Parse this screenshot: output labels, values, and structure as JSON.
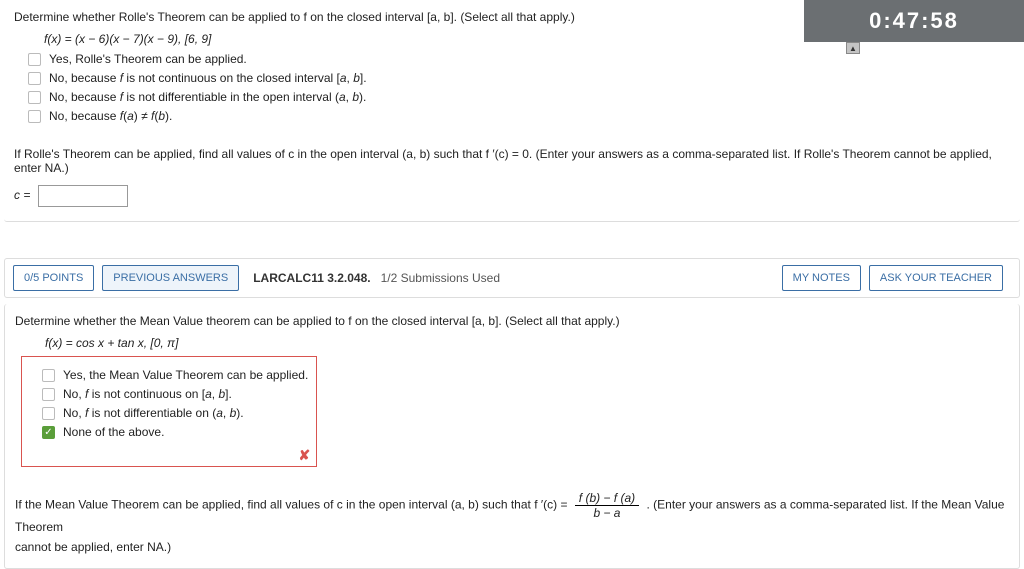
{
  "timer": "0:47:58",
  "q1": {
    "prompt": "Determine whether Rolle's Theorem can be applied to f on the closed interval [a, b]. (Select all that apply.)",
    "func": "f(x) = (x − 6)(x − 7)(x − 9),   [6, 9]",
    "opts": [
      "Yes, Rolle's Theorem can be applied.",
      "No, because f is not continuous on the closed interval [a, b].",
      "No, because f is not differentiable in the open interval (a, b).",
      "No, because f(a) ≠ f(b)."
    ],
    "follow": "If Rolle's Theorem can be applied, find all values of c in the open interval (a, b) such that f ′(c) = 0. (Enter your answers as a comma-separated list. If Rolle's Theorem cannot be applied, enter NA.)",
    "clabel": "c ="
  },
  "header": {
    "points": "0/5 POINTS",
    "prev": "PREVIOUS ANSWERS",
    "assignment": "LARCALC11 3.2.048.",
    "subs": "1/2 Submissions Used",
    "notes": "MY NOTES",
    "ask": "ASK YOUR TEACHER"
  },
  "q2": {
    "prompt": "Determine whether the Mean Value theorem can be applied to f on the closed interval [a, b]. (Select all that apply.)",
    "func": "f(x) = cos x + tan x,   [0, π]",
    "opts": [
      "Yes, the Mean Value Theorem can be applied.",
      "No, f is not continuous on [a, b].",
      "No, f is not differentiable on (a, b).",
      "None of the above."
    ],
    "follow_a": "If the Mean Value Theorem can be applied, find all values of c in the open interval (a, b) such that f ′(c) = ",
    "frac_num": "f (b) − f (a)",
    "frac_den": "b − a",
    "follow_b": ". (Enter your answers as a comma-separated list. If the Mean Value Theorem",
    "follow_c": "cannot be applied, enter NA.)"
  }
}
